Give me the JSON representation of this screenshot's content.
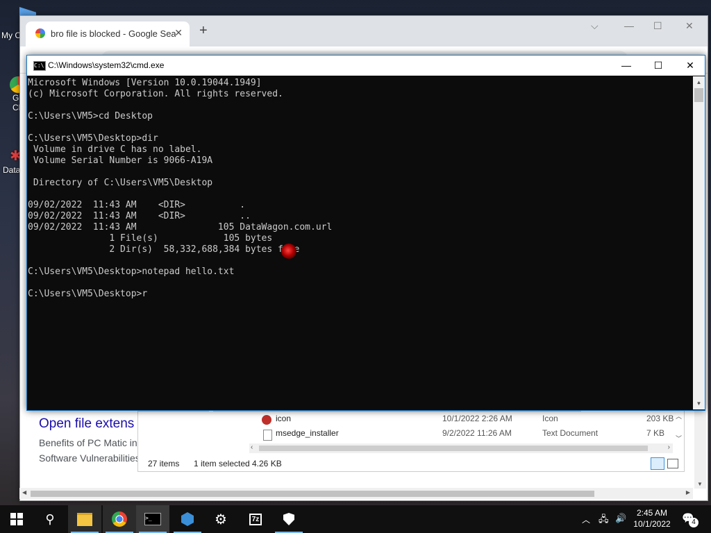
{
  "desktop": {
    "icons": [
      {
        "label": "My C",
        "icon": "this-pc-icon"
      },
      {
        "label": "G\nCl",
        "icon": "chrome-desktop-icon"
      },
      {
        "label": "Data",
        "icon": "datawagon-icon"
      }
    ]
  },
  "chrome": {
    "tab_title": "bro file is blocked - Google Search",
    "new_tab": "+",
    "close_tab": "✕",
    "page": {
      "result_title": "Open file extens",
      "snippet1": "Benefits of PC Matic inc",
      "snippet2": "Software Vulnerabilities"
    }
  },
  "explorer": {
    "files": [
      {
        "name": "icon",
        "date": "10/1/2022 2:26 AM",
        "type": "Icon",
        "size": "203 KB"
      },
      {
        "name": "msedge_installer",
        "date": "9/2/2022 11:26 AM",
        "type": "Text Document",
        "size": "7 KB"
      }
    ],
    "status_items": "27 items",
    "status_selected": "1 item selected",
    "status_size": "4.26 KB"
  },
  "cmd": {
    "title": "C:\\Windows\\system32\\cmd.exe",
    "lines": [
      "Microsoft Windows [Version 10.0.19044.1949]",
      "(c) Microsoft Corporation. All rights reserved.",
      "",
      "C:\\Users\\VM5>cd Desktop",
      "",
      "C:\\Users\\VM5\\Desktop>dir",
      " Volume in drive C has no label.",
      " Volume Serial Number is 9066-A19A",
      "",
      " Directory of C:\\Users\\VM5\\Desktop",
      "",
      "09/02/2022  11:43 AM    <DIR>          .",
      "09/02/2022  11:43 AM    <DIR>          ..",
      "09/02/2022  11:43 AM               105 DataWagon.com.url",
      "               1 File(s)            105 bytes",
      "               2 Dir(s)  58,332,688,384 bytes free",
      "",
      "C:\\Users\\VM5\\Desktop>notepad hello.txt",
      "",
      "C:\\Users\\VM5\\Desktop>r"
    ]
  },
  "taskbar": {
    "time": "2:45 AM",
    "date": "10/1/2022",
    "notification_count": "4",
    "apps": [
      "start-icon",
      "search-icon",
      "file-explorer-icon",
      "chrome-icon",
      "cmd-icon",
      "app-icon",
      "settings-icon",
      "7zip-icon",
      "security-icon"
    ]
  }
}
